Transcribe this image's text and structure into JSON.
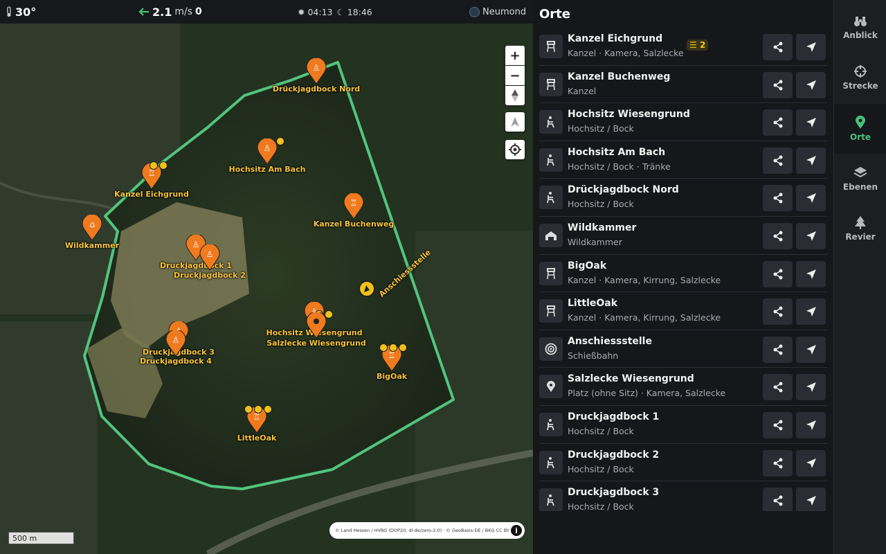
{
  "topbar": {
    "temperature": "30°",
    "wind_speed": "2.1",
    "wind_unit": "m/s",
    "wind_level": "0",
    "sunrise": "04:13",
    "sunset": "18:46",
    "moon_phase": "Neumond"
  },
  "map": {
    "labels": {
      "drueckjagdbock_nord": "Drückjagdbock Nord",
      "hochsitz_am_bach": "Hochsitz Am Bach",
      "kanzel_eichgrund": "Kanzel Eichgrund",
      "kanzel_buchenweg": "Kanzel Buchenweg",
      "wildkammer": "Wildkammer",
      "druckjagdbock_1": "Druckjagdbock 1",
      "druckjagdbock_2": "Druckjagdbock 2",
      "anschiessstelle": "Anschiessstelle",
      "hochsitz_wiesengrund": "Hochsitz Wiesengrund",
      "salzlecke_wiesengrund": "Salzlecke Wiesengrund",
      "druckjagdbock_3": "Druckjagdbock 3",
      "druckjagdbock_4": "Druckjagdbock 4",
      "bigoak": "BigOak",
      "littleoak": "LittleOak"
    },
    "zoom_in": "+",
    "zoom_out": "−",
    "scale": "500 m",
    "attribution": "© Land Hessen / HVBG (DOP20, dl-de/zero-2.0) · © GeoBasis-DE / BKG CC BY 4.0",
    "info": "i"
  },
  "panel": {
    "title": "Orte",
    "places": [
      {
        "name": "Kanzel Eichgrund",
        "sub": "Kanzel · Kamera, Salzlecke",
        "icon": "tower-icon",
        "badge": "2"
      },
      {
        "name": "Kanzel Buchenweg",
        "sub": "Kanzel",
        "icon": "tower-icon"
      },
      {
        "name": "Hochsitz Wiesengrund",
        "sub": "Hochsitz / Bock",
        "icon": "seat-icon"
      },
      {
        "name": "Hochsitz Am Bach",
        "sub": "Hochsitz / Bock · Tränke",
        "icon": "seat-icon"
      },
      {
        "name": "Drückjagdbock Nord",
        "sub": "Hochsitz / Bock",
        "icon": "seat-icon"
      },
      {
        "name": "Wildkammer",
        "sub": "Wildkammer",
        "icon": "house-icon"
      },
      {
        "name": "BigOak",
        "sub": "Kanzel · Kamera, Kirrung, Salzlecke",
        "icon": "tower-icon"
      },
      {
        "name": "LittleOak",
        "sub": "Kanzel · Kamera, Kirrung, Salzlecke",
        "icon": "tower-icon"
      },
      {
        "name": "Anschiessstelle",
        "sub": "Schießbahn",
        "icon": "target-icon"
      },
      {
        "name": "Salzlecke Wiesengrund",
        "sub": "Platz (ohne Sitz) · Kamera, Salzlecke",
        "icon": "location-pin-icon"
      },
      {
        "name": "Druckjagdbock 1",
        "sub": "Hochsitz / Bock",
        "icon": "seat-icon"
      },
      {
        "name": "Druckjagdbock 2",
        "sub": "Hochsitz / Bock",
        "icon": "seat-icon"
      },
      {
        "name": "Druckjagdbock 3",
        "sub": "Hochsitz / Bock",
        "icon": "seat-icon"
      }
    ]
  },
  "nav": {
    "anblick": "Anblick",
    "strecke": "Strecke",
    "orte": "Orte",
    "ebenen": "Ebenen",
    "revier": "Revier"
  },
  "colors": {
    "accent_green": "#45c27a",
    "pin_orange": "#f07a1e",
    "label_yellow": "#f6c33a"
  }
}
